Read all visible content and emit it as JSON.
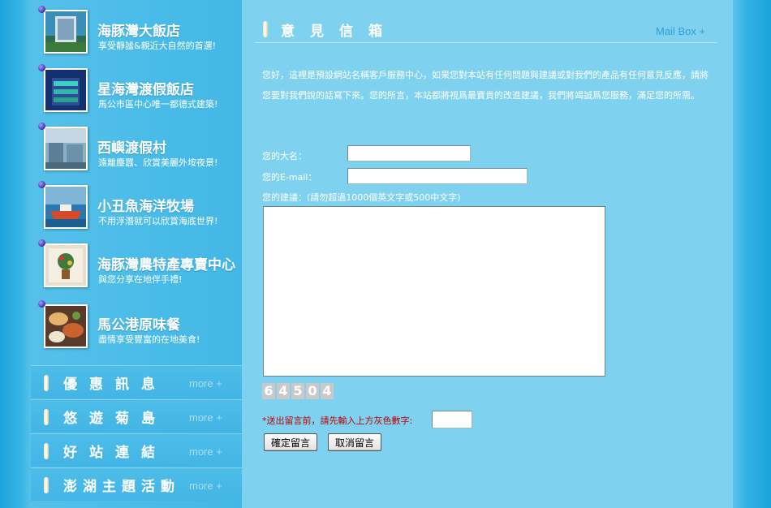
{
  "sidebar": {
    "hotels": [
      {
        "name": "海豚灣大飯店",
        "desc": "享受靜謐&親近大自然的首選!"
      },
      {
        "name": "星海灣渡假飯店",
        "desc": "馬公市區中心唯一都德式建築!"
      },
      {
        "name": "西嶼渡假村",
        "desc": "遠離塵囂、欣賞美麗外垵夜景!"
      },
      {
        "name": "小丑魚海洋牧場",
        "desc": "不用浮潛就可以欣賞海底世界!"
      },
      {
        "name": "海豚灣農特產專賣中心",
        "desc": "與您分享在地伴手禮!"
      },
      {
        "name": "馬公港原味餐",
        "desc": "盡情享受豐富的在地美食!"
      }
    ],
    "menu": [
      {
        "label": "優惠訊息",
        "more": "more +"
      },
      {
        "label": "悠遊菊島",
        "more": "more +"
      },
      {
        "label": "好站連結",
        "more": "more +"
      },
      {
        "label": "澎湖主題活動",
        "more": "more +"
      }
    ]
  },
  "main": {
    "title": "意見信箱",
    "subtitle": "Mail Box +",
    "intro": "您好，這裡是預設網站名稱客戶服務中心，如果您對本站有任何問題與建議或對我們的產品有任何意見反應，請將您要對我們說的話寫下來。您的所言，本站都將視爲最寶貴的改進建議，我們將竭誠爲您服務，滿足您的所需。",
    "form": {
      "name_label": "您的大名：",
      "email_label": "您的E-mail：",
      "suggestion_label": "您的建議：(請勿超過1000個英文字或500中文字)",
      "name_value": "",
      "email_value": "",
      "suggestion_value": "",
      "captcha_digits": [
        "6",
        "4",
        "5",
        "0",
        "4"
      ],
      "captcha_prompt": "*送出留言前，請先輸入上方灰色數字:",
      "captcha_value": "",
      "submit_label": "確定留言",
      "cancel_label": "取消留言"
    }
  },
  "colors": {
    "page_bg": "#1ea8e0",
    "sidebar_bg": "#4bbce8",
    "main_bg": "#7fd2ef",
    "warn": "#c00000",
    "accent_link": "#2f9fd6"
  }
}
